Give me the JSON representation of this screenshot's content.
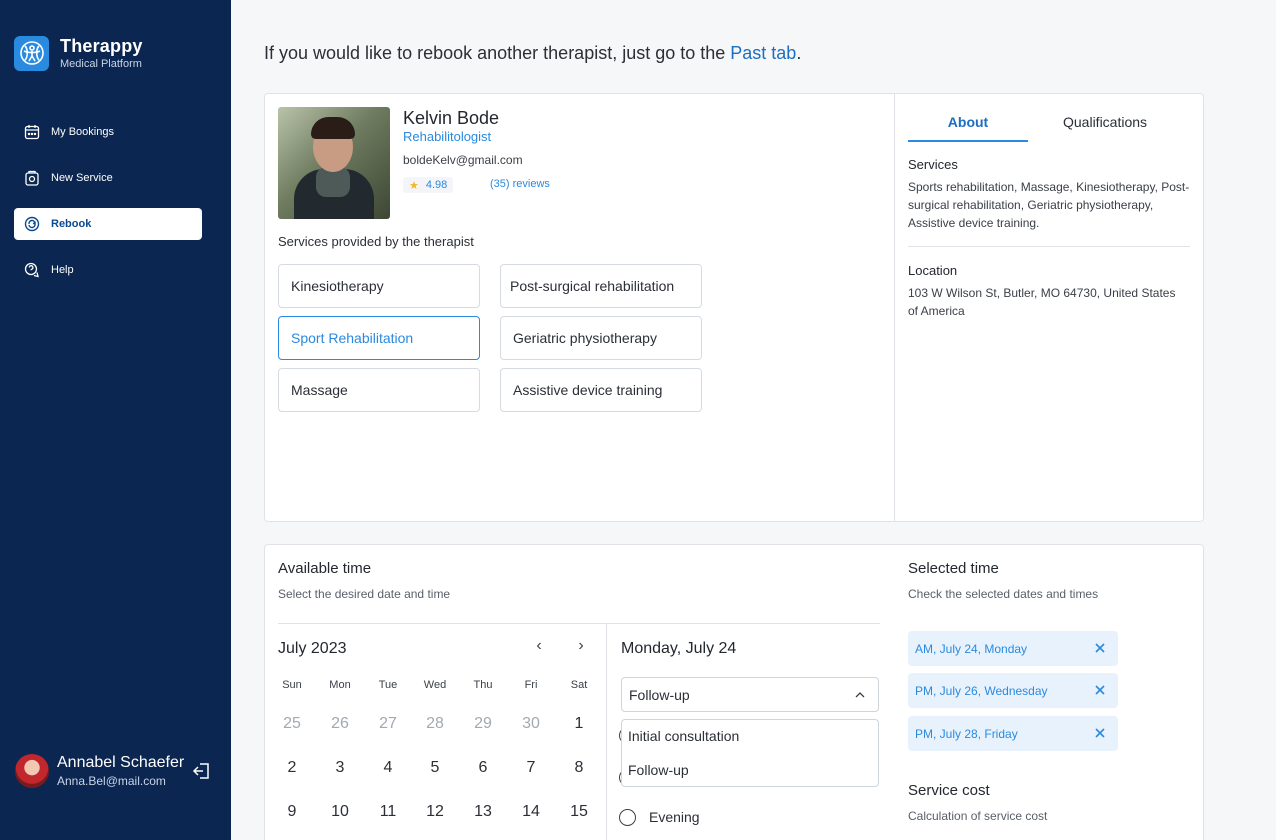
{
  "brand": {
    "title": "Therappy",
    "subtitle": "Medical Platform",
    "logo_icon": "body-icon",
    "accent": "#2a8ae0",
    "sidebar_bg": "#0b2650"
  },
  "nav": [
    {
      "label": "My Bookings",
      "icon": "calendar-icon"
    },
    {
      "label": "New Service",
      "icon": "new-service-icon"
    },
    {
      "label": "Rebook",
      "icon": "rebook-icon",
      "active": true
    },
    {
      "label": "Help",
      "icon": "help-icon"
    }
  ],
  "user": {
    "name": "Annabel Schaefer",
    "email": "Anna.Bel@mail.com"
  },
  "intro": {
    "text": "If you would like to rebook another therapist, just go to the ",
    "link": "Past tab",
    "end": "."
  },
  "therapist": {
    "name": "Kelvin Bode",
    "role": "Rehabilitologist",
    "email": "boldeKelv@gmail.com",
    "rating": "4.98",
    "reviews": "(35) reviews",
    "services_heading": "Services provided by the therapist",
    "services": [
      {
        "label": "Kinesiotherapy",
        "selected": false
      },
      {
        "label": "Post-surgical rehabilitation",
        "selected": false
      },
      {
        "label": "Sport Rehabilitation",
        "selected": true
      },
      {
        "label": "Geriatric physiotherapy",
        "selected": false
      },
      {
        "label": "Massage",
        "selected": false
      },
      {
        "label": "Assistive device training",
        "selected": false
      }
    ]
  },
  "tabs": {
    "about": "About",
    "qualifications": "Qualifications"
  },
  "about": {
    "services_heading": "Services",
    "services_text": "Sports rehabilitation, Massage, Kinesiotherapy, Post-surgical rehabilitation, Geriatric physiotherapy, Assistive device training.",
    "location_heading": "Location",
    "location_text": "103 W Wilson St, Butler, MO 64730, United States of America"
  },
  "available": {
    "title": "Available time",
    "subtitle": "Select the desired date and time",
    "month": "July 2023",
    "weekdays": [
      "Sun",
      "Mon",
      "Tue",
      "Wed",
      "Thu",
      "Fri",
      "Sat"
    ],
    "weeks": [
      [
        "25",
        "26",
        "27",
        "28",
        "29",
        "30",
        "1"
      ],
      [
        "2",
        "3",
        "4",
        "5",
        "6",
        "7",
        "8"
      ],
      [
        "9",
        "10",
        "11",
        "12",
        "13",
        "14",
        "15"
      ]
    ],
    "selected_date": "Monday, July 24",
    "select_value": "Follow-up",
    "options": [
      "Initial consultation",
      "Follow-up"
    ],
    "time_slot": "Evening"
  },
  "selected": {
    "title": "Selected time",
    "subtitle": "Check the selected dates and times",
    "items": [
      "AM, July 24, Monday",
      "PM, July 26, Wednesday",
      "PM, July 28, Friday"
    ],
    "cost_title": "Service cost",
    "cost_subtitle": "Calculation of service cost"
  }
}
